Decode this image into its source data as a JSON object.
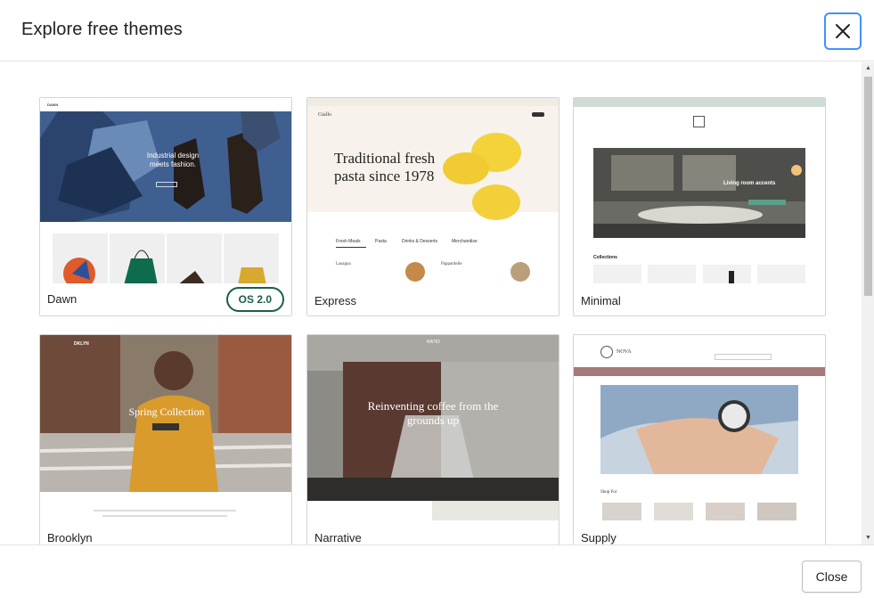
{
  "header": {
    "title": "Explore free themes",
    "close_icon": "close-icon"
  },
  "themes": [
    {
      "name": "Dawn",
      "badge": "OS 2.0",
      "preview": {
        "brand": "DAWN",
        "hero_text": "Industrial design meets fashion."
      }
    },
    {
      "name": "Express",
      "preview": {
        "brand": "Giallo",
        "hero_text": "Traditional fresh pasta since 1978",
        "tabs": [
          "Fresh Meals",
          "Pasta",
          "Drinks & Desserts",
          "Merchandise"
        ],
        "items": [
          "Lasagna",
          "Pappardelle"
        ]
      }
    },
    {
      "name": "Minimal",
      "preview": {
        "hero_text": "Living room accents",
        "section": "Collections"
      }
    },
    {
      "name": "Brooklyn",
      "preview": {
        "brand": "DKLYN",
        "hero_text": "Spring Collection"
      }
    },
    {
      "name": "Narrative",
      "preview": {
        "brand": "RATIO",
        "hero_text": "Reinventing coffee from the grounds up"
      }
    },
    {
      "name": "Supply",
      "preview": {
        "brand": "NOVA",
        "section": "Shop For"
      }
    }
  ],
  "footer": {
    "close_label": "Close"
  },
  "colors": {
    "focus_ring": "#458fff",
    "badge": "#1b5e4b",
    "border": "#d2d5d8"
  }
}
